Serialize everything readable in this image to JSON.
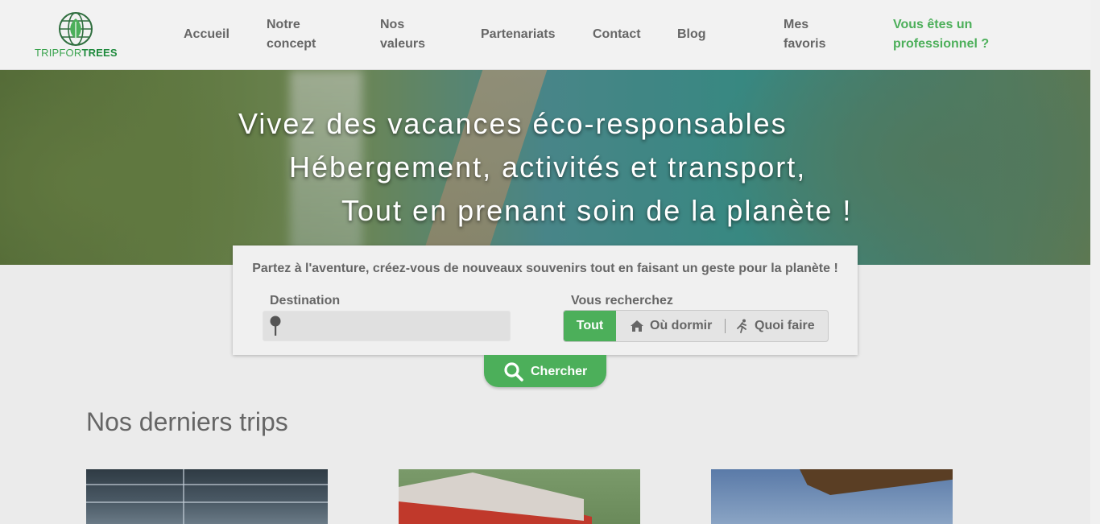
{
  "brand": {
    "logo_part1": "TRIPFOR",
    "logo_part2": "TREES",
    "accent": "#4caf5a"
  },
  "nav": {
    "home": "Accueil",
    "concept_l1": "Notre",
    "concept_l2": "concept",
    "values_l1": "Nos",
    "values_l2": "valeurs",
    "partners": "Partenariats",
    "contact": "Contact",
    "blog": "Blog",
    "favorites_l1": "Mes",
    "favorites_l2": "favoris",
    "pro_l1": "Vous êtes un",
    "pro_l2": "professionnel ?"
  },
  "hero": {
    "line1": "Vivez des vacances éco-responsables",
    "line2": "Hébergement, activités et transport,",
    "line3": "Tout en prenant soin de la planète !"
  },
  "search": {
    "intro": "Partez à l'aventure, créez-vous de nouveaux souvenirs tout en faisant un geste pour la planète !",
    "destination_label": "Destination",
    "destination_value": "",
    "type_label": "Vous recherchez",
    "options": {
      "all": "Tout",
      "sleep": "Où dormir",
      "do": "Quoi faire"
    },
    "selected": "Tout",
    "button": "Chercher"
  },
  "trips": {
    "title": "Nos derniers trips"
  }
}
